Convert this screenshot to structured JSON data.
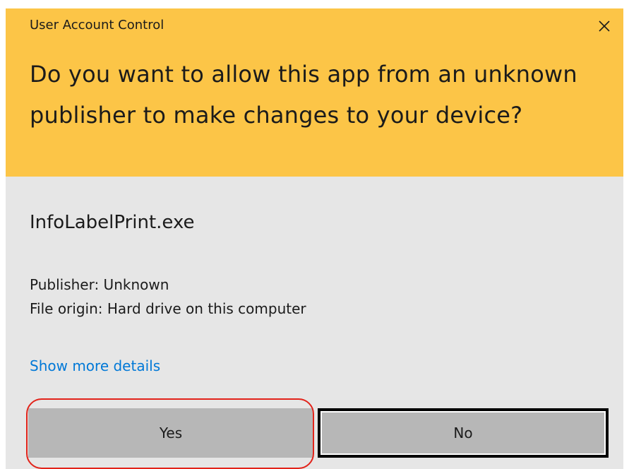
{
  "dialog": {
    "title": "User Account Control",
    "question": "Do you want to allow this app from an unknown publisher to make changes to your device?",
    "app_name": "InfoLabelPrint.exe",
    "publisher": "Publisher: Unknown",
    "file_origin": "File origin: Hard drive on this computer",
    "details_link": "Show more details",
    "close_icon": "close-icon"
  },
  "buttons": {
    "yes_label": "Yes",
    "no_label": "No"
  },
  "colors": {
    "header_background": "#fcc547",
    "body_background": "#e6e6e6",
    "link": "#0078d7",
    "button": "#b7b7b7",
    "highlight": "#e2231a"
  }
}
